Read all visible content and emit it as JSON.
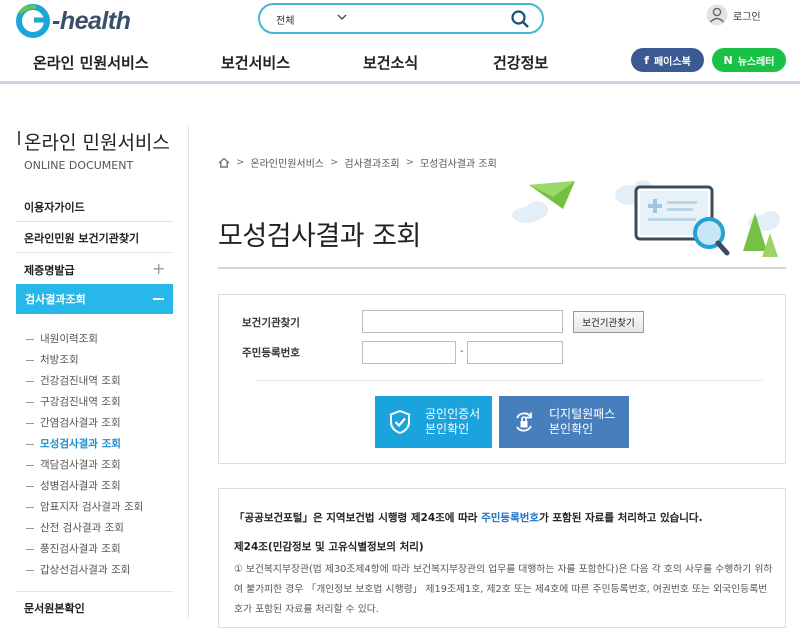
{
  "header": {
    "logo_text": "-health",
    "search": {
      "select_value": "전체",
      "placeholder": ""
    },
    "login_label": "로그인",
    "gnb": [
      "온라인 민원서비스",
      "보건서비스",
      "보건소식",
      "건강정보"
    ],
    "facebook_label": "페이스북",
    "facebook_icon_text": "f",
    "newsletter_label": "뉴스레터",
    "newsletter_icon_text": "N"
  },
  "sidebar": {
    "title": "온라인 민원서비스",
    "subtitle": "ONLINE DOCUMENT",
    "menu": {
      "guide": "이용자가이드",
      "find_center": "온라인민원 보건기관찾기",
      "certificate": "제증명발급",
      "exam_results": "검사결과조회",
      "doc_verify": "문서원본확인"
    },
    "sub_items": [
      "내원이력조회",
      "처방조회",
      "건강검진내역 조회",
      "구강검진내역 조회",
      "간염검사결과 조회",
      "모성검사결과 조회",
      "객담검사결과 조회",
      "성병검사결과 조회",
      "암표지자 검사결과 조회",
      "산전 검사결과 조회",
      "풍진검사결과 조회",
      "갑상선검사결과 조회"
    ],
    "active_sub_index": 5
  },
  "main": {
    "breadcrumb": [
      "온라인민원서비스",
      "검사결과조회",
      "모성검사결과 조회"
    ],
    "title": "모성검사결과 조회",
    "form": {
      "center_label": "보건기관찾기",
      "center_value": "",
      "center_button": "보건기관찾기",
      "rrn_label": "주민등록번호",
      "rrn_front": "",
      "rrn_back": "",
      "rrn_separator": "-"
    },
    "buttons": {
      "cert_line1": "공인인증서",
      "cert_line2": "본인확인",
      "digital_line1": "디지털원패스",
      "digital_line2": "본인확인"
    },
    "notice": {
      "line1_prefix": "「공공보건포털」은 지역보건법 시행령 제24조에 따라 ",
      "line1_emphasis": "주민등록번호",
      "line1_suffix": "가 포함된 자료를 처리하고 있습니다.",
      "heading": "제24조(민감정보 및 고유식별정보의 처리)",
      "body": "① 보건복지부장관(법 제30조제4항에 따라 보건복지부장관의 업무를 대행하는 자를 포함한다)은 다음 각 호의 사무를 수행하기 위하여 불가피한 경우 「개인정보 보호법 시행령」 제19조제1호, 제2호 또는 제4호에 따른 주민등록번호, 여권번호 또는 외국인등록번호가 포함된 자료를 처리할 수 있다."
    }
  },
  "colors": {
    "accent": "#27b7e8",
    "search_border": "#45b6d3",
    "facebook": "#3b5a93",
    "newsletter": "#19c244",
    "cert_button": "#1ba3dd",
    "digital_button": "#477fbc",
    "emphasis": "#1a73c9"
  }
}
